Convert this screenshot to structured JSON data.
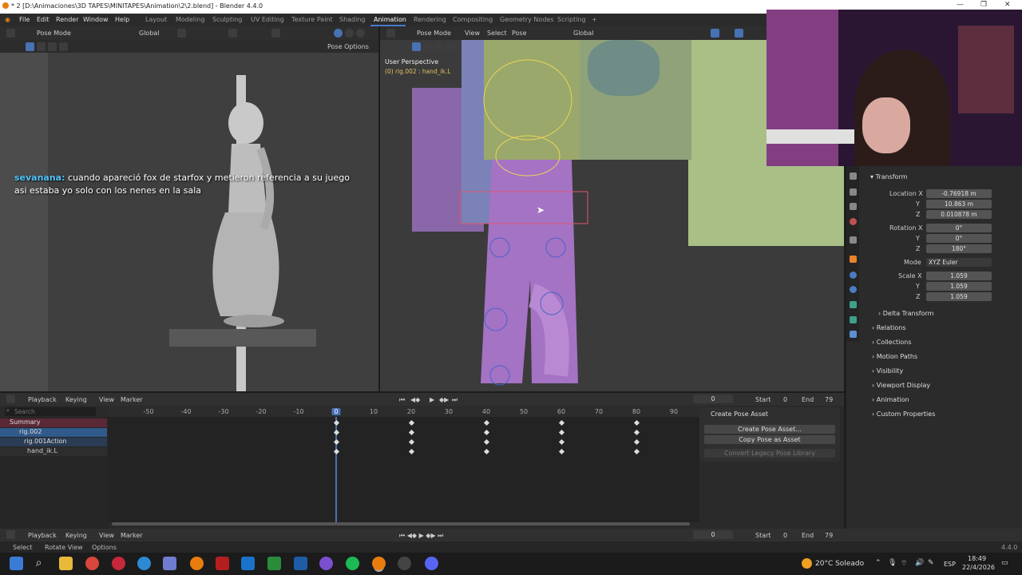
{
  "window": {
    "title": "* 2 [D:\\Animaciones\\3D TAPES\\MINITAPES\\Animation\\2\\2.blend] - Blender 4.4.0"
  },
  "menu": [
    "File",
    "Edit",
    "Render",
    "Window",
    "Help"
  ],
  "workspaces": [
    "Layout",
    "Modeling",
    "Sculpting",
    "UV Editing",
    "Texture Paint",
    "Shading",
    "Animation",
    "Rendering",
    "Compositing",
    "Geometry Nodes",
    "Scripting"
  ],
  "left_header": {
    "mode": "Pose Mode",
    "orientation": "Global",
    "pose_options": "Pose Options"
  },
  "right_header": {
    "mode": "Pose Mode",
    "view": "View",
    "select": "Select",
    "pose": "Pose",
    "orientation": "Global"
  },
  "viewport": {
    "perspective": "User Perspective",
    "object": "(0) rig.002 : hand_ik.L"
  },
  "chat": {
    "user": "sevanana:",
    "message": "cuando apareció fox de starfox y metieron referencia a su juego asi estaba yo solo con los nenes en la sala"
  },
  "properties": {
    "transform_label": "Transform",
    "location_label": "Location X",
    "loc_x": "-0.76918 m",
    "loc_y": "10.863 m",
    "loc_z": "0.010878 m",
    "rotation_label": "Rotation X",
    "rot_x": "0°",
    "rot_y": "0°",
    "rot_z": "180°",
    "mode_label": "Mode",
    "mode_value": "XYZ Euler",
    "scale_label": "Scale X",
    "sc_x": "1.059",
    "sc_y": "1.059",
    "sc_z": "1.059",
    "y": "Y",
    "z": "Z",
    "delta": "Delta Transform",
    "sections": [
      "Relations",
      "Collections",
      "Motion Paths",
      "Visibility",
      "Viewport Display",
      "Animation",
      "Custom Properties"
    ]
  },
  "timeline": {
    "playback": "Playback",
    "keying": "Keying",
    "view": "View",
    "marker": "Marker",
    "current_frame": "0",
    "start_label": "Start",
    "start": "0",
    "end_label": "End",
    "end": "79",
    "ticks": [
      "-50",
      "-40",
      "-30",
      "-20",
      "-10",
      "0",
      "10",
      "20",
      "30",
      "40",
      "50",
      "60",
      "70",
      "80",
      "90"
    ],
    "search_placeholder": "Search",
    "channels": [
      "Summary",
      "rig.002",
      "rig.001Action",
      "hand_ik.L"
    ],
    "keyframes": [
      0,
      20,
      40,
      60,
      80
    ]
  },
  "pose_asset": {
    "title": "Create Pose Asset",
    "create": "Create Pose Asset...",
    "copy": "Copy Pose as Asset",
    "convert": "Convert Legacy Pose Library"
  },
  "status": {
    "select": "Select",
    "rotate": "Rotate View",
    "options": "Options",
    "version": "4.4.0"
  },
  "taskbar": {
    "weather": "20°C Soleado",
    "lang": "ESP",
    "time": "18:49",
    "date": "22/4/2026"
  }
}
